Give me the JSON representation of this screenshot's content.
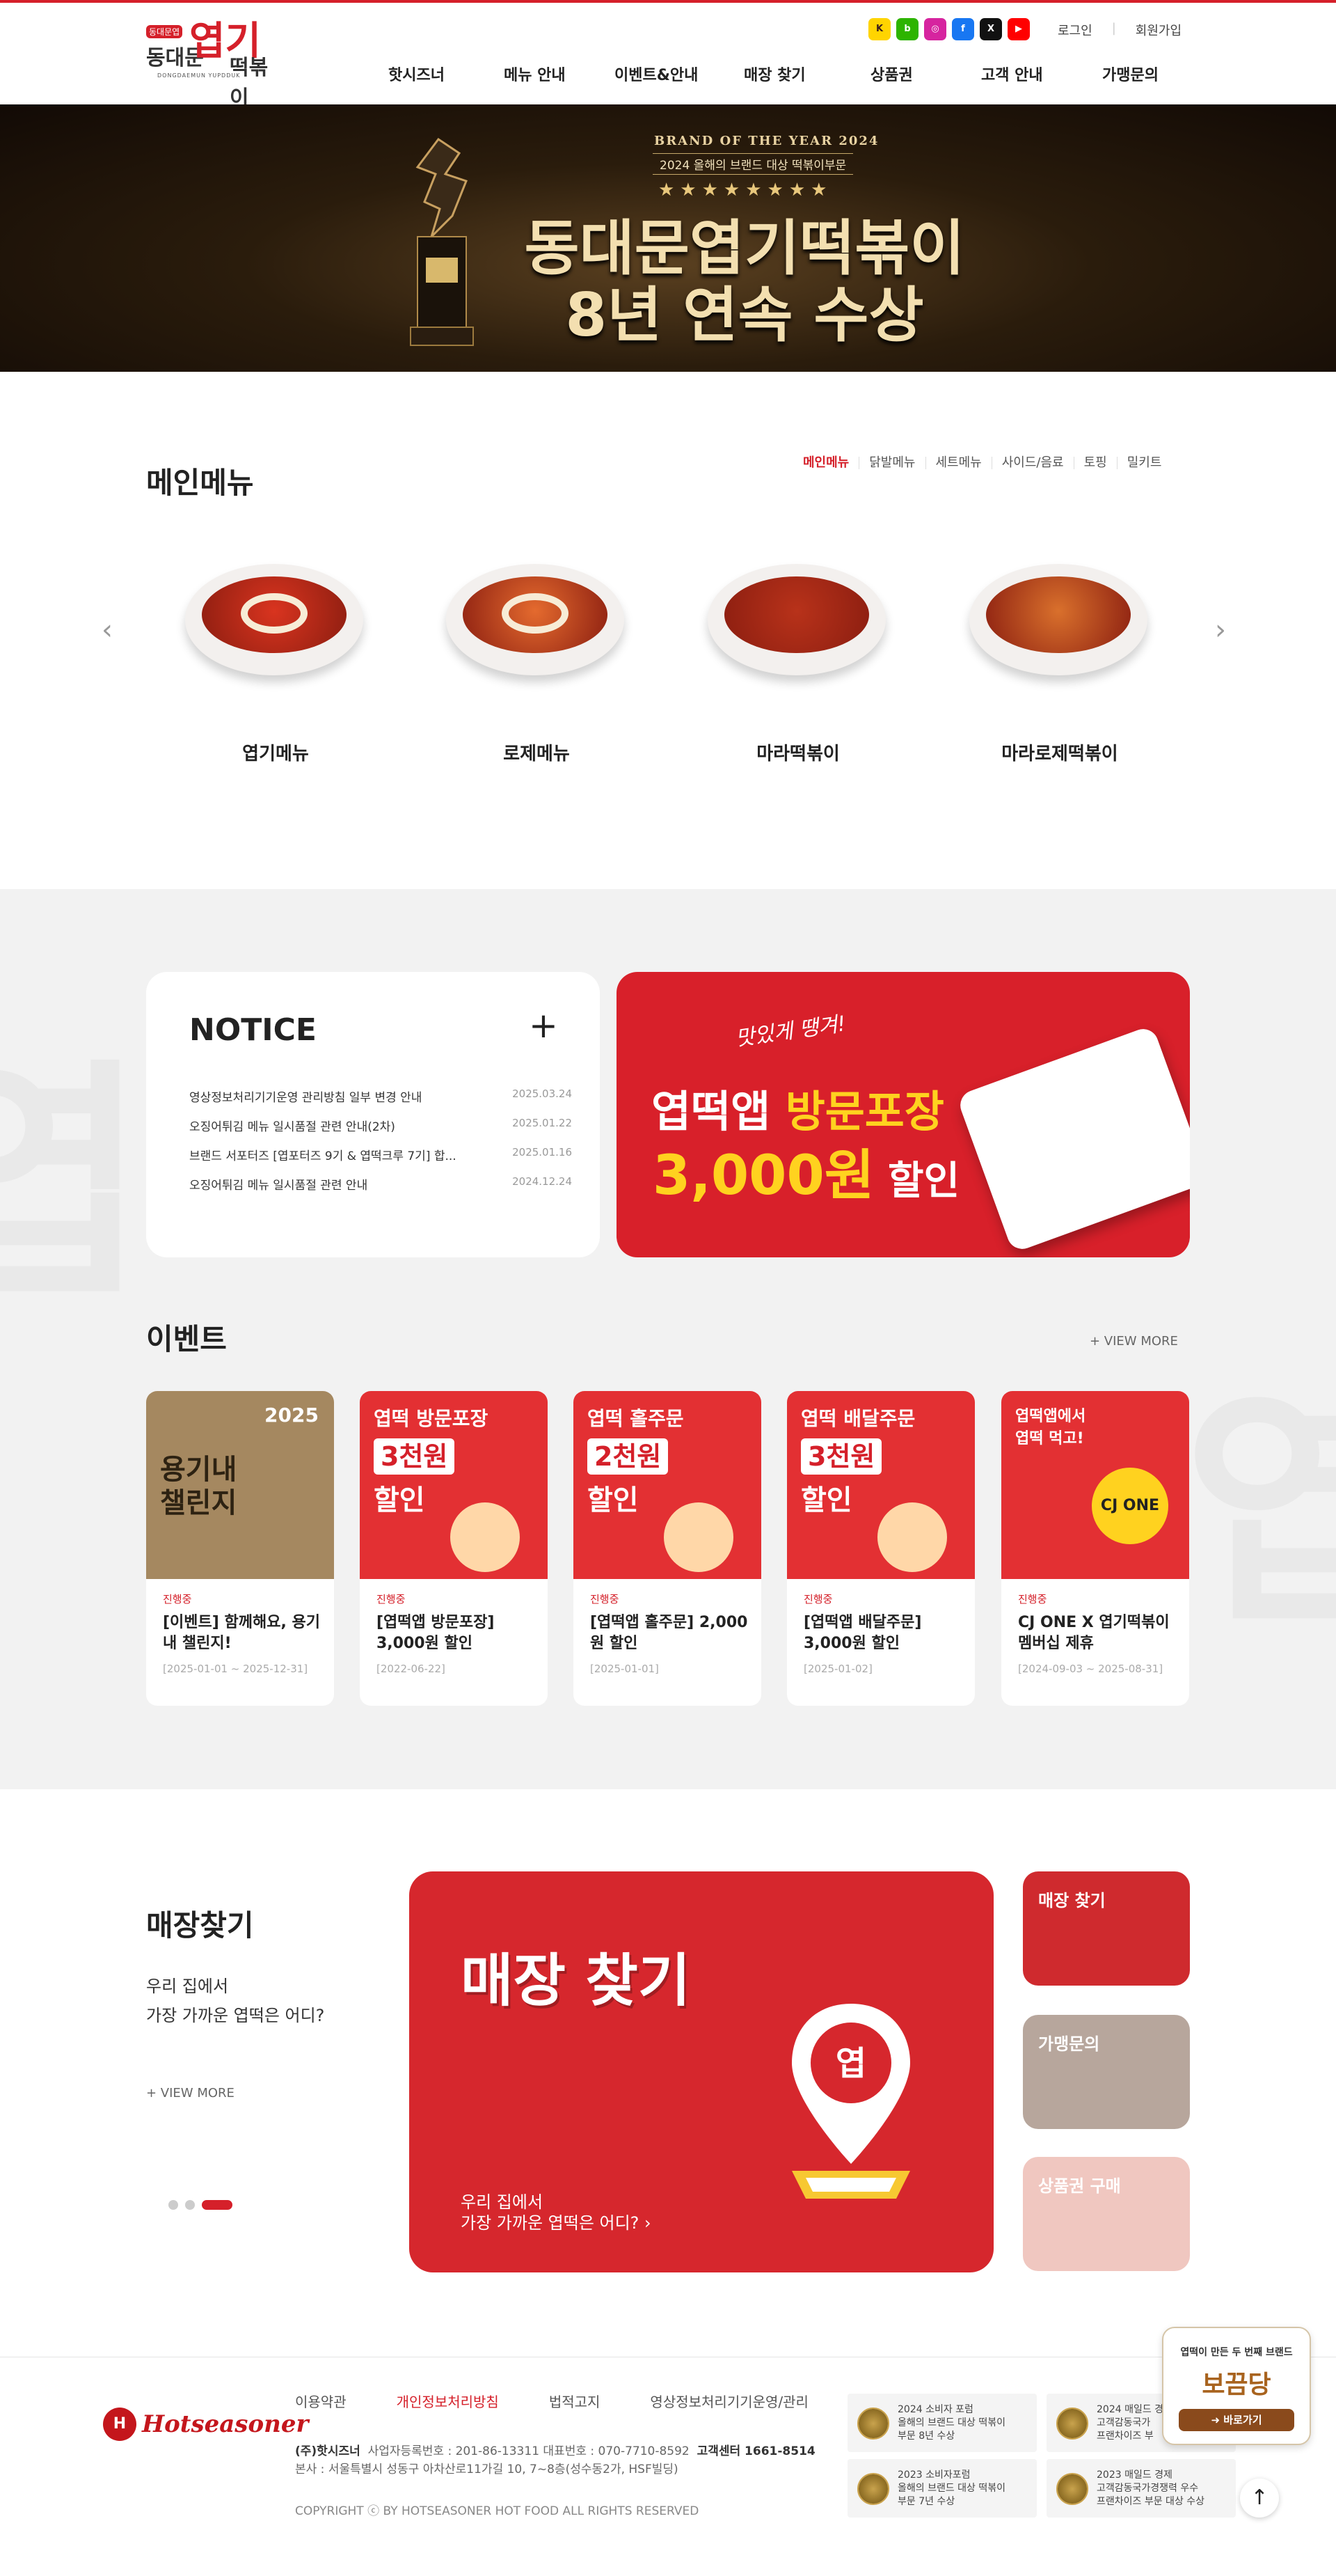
{
  "brand": {
    "logo_tag": "동대문엽",
    "logo_left": "동대문",
    "logo_main": "엽기",
    "logo_right": "떡볶이",
    "logo_en": "DONGDAEMUN YUPDDUK"
  },
  "sns": [
    {
      "name": "kakao-icon",
      "glyph": "K",
      "color": "#ffd400"
    },
    {
      "name": "naver-blog-icon",
      "glyph": "b",
      "color": "#2db400"
    },
    {
      "name": "instagram-icon",
      "glyph": "◎",
      "color": "#d6249f"
    },
    {
      "name": "facebook-icon",
      "glyph": "f",
      "color": "#1877f2"
    },
    {
      "name": "x-icon",
      "glyph": "X",
      "color": "#111111"
    },
    {
      "name": "youtube-icon",
      "glyph": "▶",
      "color": "#ff0000"
    }
  ],
  "util": {
    "login": "로그인",
    "join": "회원가입"
  },
  "gnb": [
    "핫시즈너",
    "메뉴 안내",
    "이벤트&안내",
    "매장 찾기",
    "상품권",
    "고객 안내",
    "가맹문의"
  ],
  "banner": {
    "boy": "BRAND OF THE YEAR 2024",
    "sub": "2024 올해의 브랜드 대상 떡볶이부문",
    "stars": "★★★★★★★★",
    "line1": "동대문엽기떡볶이",
    "line2": "8년 연속 수상"
  },
  "main_menu": {
    "title": "메인메뉴",
    "tabs": [
      "메인메뉴",
      "닭발메뉴",
      "세트메뉴",
      "사이드/음료",
      "토핑",
      "밀키트"
    ],
    "prev": "‹",
    "next": "›",
    "items": [
      {
        "label": "엽기메뉴",
        "sauce": "#d9341f"
      },
      {
        "label": "로제메뉴",
        "sauce": "#e46a2e"
      },
      {
        "label": "마라떡볶이",
        "sauce": "#b8321a"
      },
      {
        "label": "마라로제떡볶이",
        "sauce": "#d9702c"
      }
    ]
  },
  "notice": {
    "title": "NOTICE",
    "plus": "+",
    "items": [
      {
        "title": "영상정보처리기기운영 관리방침 일부 변경 안내",
        "date": "2025.03.24"
      },
      {
        "title": "오징어튀김 메뉴 일시품절 관련 안내(2차)",
        "date": "2025.01.22"
      },
      {
        "title": "브랜드 서포터즈 [엽포터즈 9기 & 엽떡크루 7기] 합...",
        "date": "2025.01.16"
      },
      {
        "title": "오징어튀김 메뉴 일시품절 관련 안내",
        "date": "2024.12.24"
      }
    ]
  },
  "promo": {
    "tagline": "맛있게 땡겨!",
    "line1a": "엽떡앱 ",
    "line1b": "방문포장",
    "line2a": "3,000원",
    "line2b": " 할인"
  },
  "events": {
    "title": "이벤트",
    "more": "+ VIEW MORE",
    "cards": [
      {
        "img_title": "2025",
        "img_badge": "용기내",
        "img_sub": "챌린지",
        "status": "진행중",
        "title": "[이벤트] 함께해요, 용기내 챌린지!",
        "date": "[2025-01-01 ~ 2025-12-31]",
        "bg": "#a58860"
      },
      {
        "img_title": "엽떡 방문포장",
        "img_badge": "3천원",
        "img_sub": "할인",
        "status": "진행중",
        "title": "[엽떡앱 방문포장] 3,000원 할인",
        "date": "[2022-06-22]",
        "bg": "#e33033"
      },
      {
        "img_title": "엽떡 홀주문",
        "img_badge": "2천원",
        "img_sub": "할인",
        "status": "진행중",
        "title": "[엽떡앱 홀주문] 2,000원 할인",
        "date": "[2025-01-01]",
        "bg": "#e33033"
      },
      {
        "img_title": "엽떡 배달주문",
        "img_badge": "3천원",
        "img_sub": "할인",
        "status": "진행중",
        "title": "[엽떡앱 배달주문] 3,000원 할인",
        "date": "[2025-01-02]",
        "bg": "#e33033"
      },
      {
        "img_title": "엽떡앱에서",
        "img_badge": "CJ ONE",
        "img_sub": "엽떡 먹고!",
        "status": "진행중",
        "title": "CJ ONE X 엽기떡볶이 멤버십 제휴",
        "date": "[2024-09-03 ~ 2025-08-31]",
        "bg": "#e33033"
      }
    ]
  },
  "store": {
    "title": "매장찾기",
    "desc1": "우리 집에서",
    "desc2": "가장 가까운 엽떡은 어디?",
    "more": "+ VIEW MORE",
    "big_title": "매장 찾기",
    "big_desc1": "우리 집에서",
    "big_desc2": "가장 가까운 엽떡은 어디? ›",
    "side": [
      {
        "label": "매장 찾기",
        "bg": "#cf2a2e"
      },
      {
        "label": "가맹문의",
        "bg": "#b7a69c"
      },
      {
        "label": "상품권 구매",
        "bg": "#f0c7c0"
      }
    ]
  },
  "footer": {
    "logo_mark": "H",
    "logo_word": "Hotseasoner",
    "links": [
      "이용약관",
      "개인정보처리방침",
      "법적고지",
      "영상정보처리기기운영/관리"
    ],
    "company": "(주)핫시즈너",
    "biz": "사업자등록번호 : 201-86-13311   대표번호 : 070-7710-8592",
    "cs_label": "고객센터 1661-8514",
    "address": "본사 : 서울특별시 성동구 아차산로11가길 10, 7~8층(성수동2가, HSF빌딩)",
    "copyright": "COPYRIGHT ⓒ BY HOTSEASONER HOT FOOD ALL RIGHTS RESERVED",
    "awards": [
      "2024 소비자 포럼\n올해의 브랜드 대상 떡볶이\n부문 8년 수상",
      "2024 매일드 경제\n고객감동국가\n프랜차이즈 부",
      "2023 소비자포럼\n올해의 브랜드 대상 떡볶이\n부문 7년 수상",
      "2023 매일드 경제\n고객감동국가경쟁력 우수\n프랜차이즈 부문 대상 수상"
    ]
  },
  "quick": {
    "line1": "엽떡이 만든 두 번째 브랜드",
    "line2": "보끔당",
    "button": "➜ 바로가기"
  },
  "totop": "↑"
}
